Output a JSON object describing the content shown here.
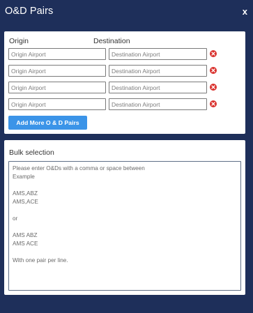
{
  "dialog": {
    "title": "O&D Pairs",
    "close_label": "x"
  },
  "pairs_panel": {
    "origin_header": "Origin",
    "destination_header": "Destination",
    "rows": [
      {
        "origin_value": "",
        "origin_placeholder": "Origin Airport",
        "destination_value": "",
        "destination_placeholder": "Destination Airport"
      },
      {
        "origin_value": "",
        "origin_placeholder": "Origin Airport",
        "destination_value": "",
        "destination_placeholder": "Destination Airport"
      },
      {
        "origin_value": "",
        "origin_placeholder": "Origin Airport",
        "destination_value": "",
        "destination_placeholder": "Destination Airport"
      },
      {
        "origin_value": "",
        "origin_placeholder": "Origin Airport",
        "destination_value": "",
        "destination_placeholder": "Destination Airport"
      }
    ],
    "remove_icon": "remove-circle-icon",
    "add_button_label": "Add More O & D Pairs"
  },
  "bulk_panel": {
    "label": "Bulk selection",
    "value": "",
    "placeholder": "Please enter O&Ds with a comma or space between\nExample\n\nAMS,ABZ\nAMS,ACE\n\nor\n\nAMS ABZ\nAMS ACE\n\nWith one pair per line."
  },
  "colors": {
    "background": "#1e2f5a",
    "panel": "#ffffff",
    "accent_button": "#3b94e8",
    "remove_icon": "#d9302c"
  }
}
